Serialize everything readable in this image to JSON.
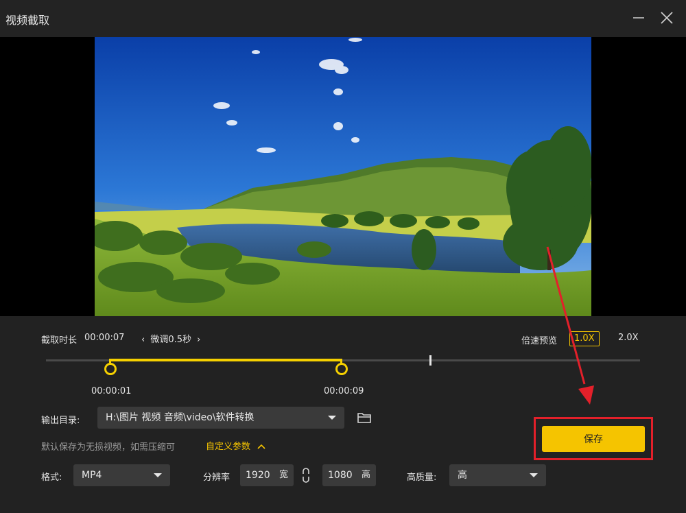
{
  "window": {
    "title": "视频截取"
  },
  "trim": {
    "duration_label": "截取时长",
    "duration_value": "00:00:07",
    "fine_tune_label": "微调0.5秒",
    "start_time": "00:00:01",
    "end_time": "00:00:09"
  },
  "speed": {
    "label": "倍速预览",
    "option_1x": "1.0X",
    "option_2x": "2.0X"
  },
  "output": {
    "dir_label": "输出目录:",
    "dir_value": "H:\\图片 视频 音频\\video\\软件转换",
    "hint": "默认保存为无损视频，如需压缩可",
    "custom_params": "自定义参数"
  },
  "format": {
    "label": "格式:",
    "value": "MP4"
  },
  "resolution": {
    "label": "分辨率",
    "width": "1920",
    "width_unit": "宽",
    "height": "1080",
    "height_unit": "高"
  },
  "quality": {
    "label": "高质量:",
    "value": "高"
  },
  "actions": {
    "save_label": "保存"
  },
  "colors": {
    "accent": "#f5c400",
    "annotation": "#e3202a",
    "background": "#222222"
  }
}
